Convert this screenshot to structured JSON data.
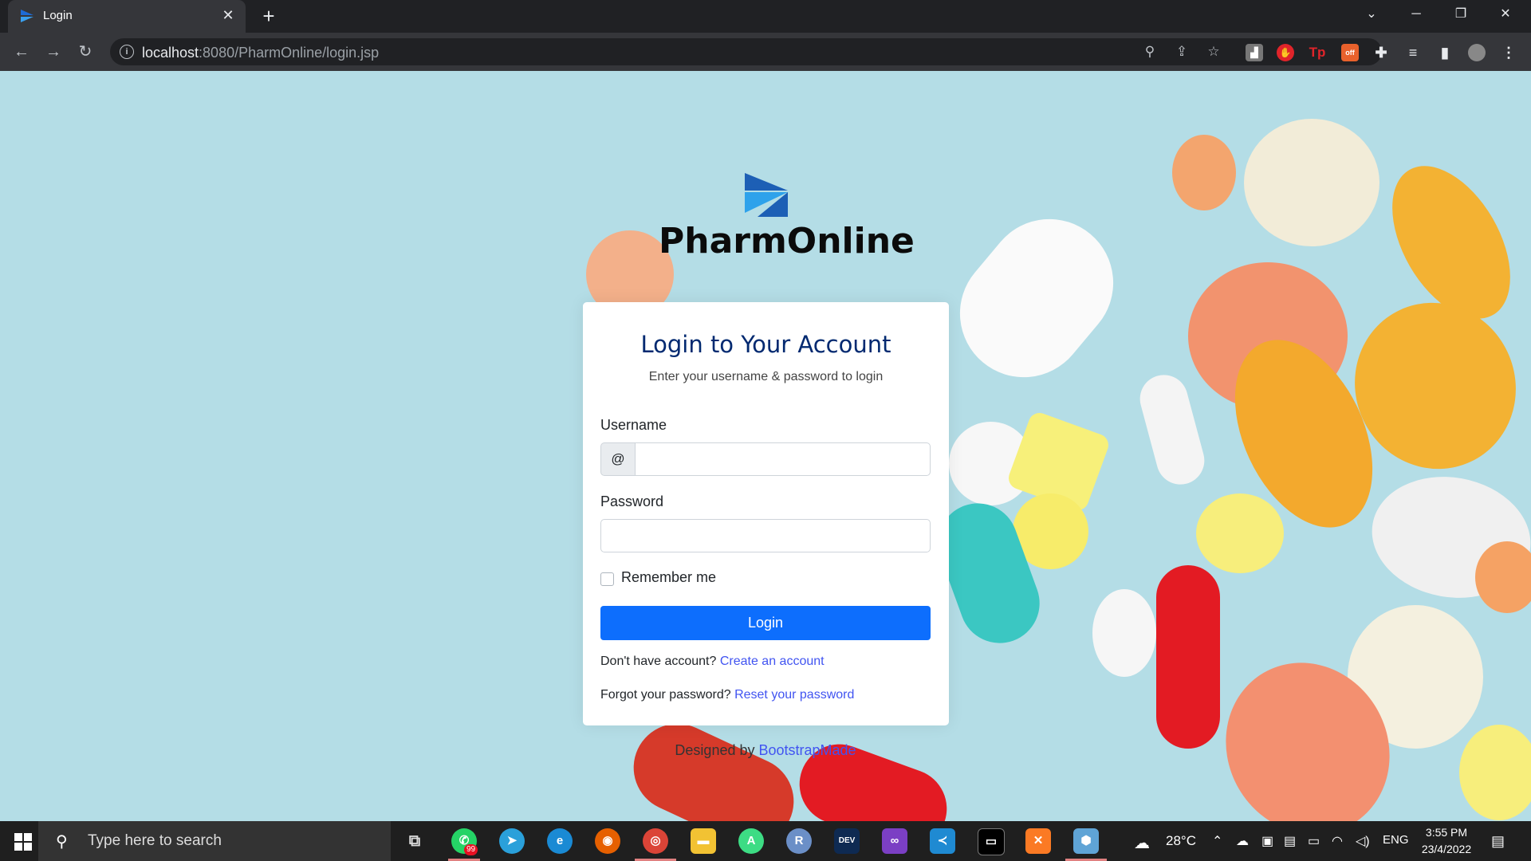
{
  "browser": {
    "tab_title": "Login",
    "url_host": "localhost",
    "url_rest": ":8080/PharmOnline/login.jsp"
  },
  "brand": {
    "name": "PharmOnline"
  },
  "login": {
    "title": "Login to Your Account",
    "subtitle": "Enter your username & password to login",
    "username_label": "Username",
    "username_prefix": "@",
    "password_label": "Password",
    "remember_label": "Remember me",
    "button_label": "Login",
    "no_account_text": "Don't have account? ",
    "create_link": "Create an account",
    "forgot_text": "Forgot your password? ",
    "reset_link": "Reset your password"
  },
  "credits": {
    "text": "Designed by ",
    "link": "BootstrapMade"
  },
  "taskbar": {
    "search_placeholder": "Type here to search",
    "whatsapp_badge": "99",
    "weather": "28°C",
    "language": "ENG",
    "time": "3:55 PM",
    "date": "23/4/2022"
  },
  "colors": {
    "accent": "#0d6efd",
    "title": "#012970",
    "link": "#4154f1",
    "page_bg": "#b4dde6"
  }
}
